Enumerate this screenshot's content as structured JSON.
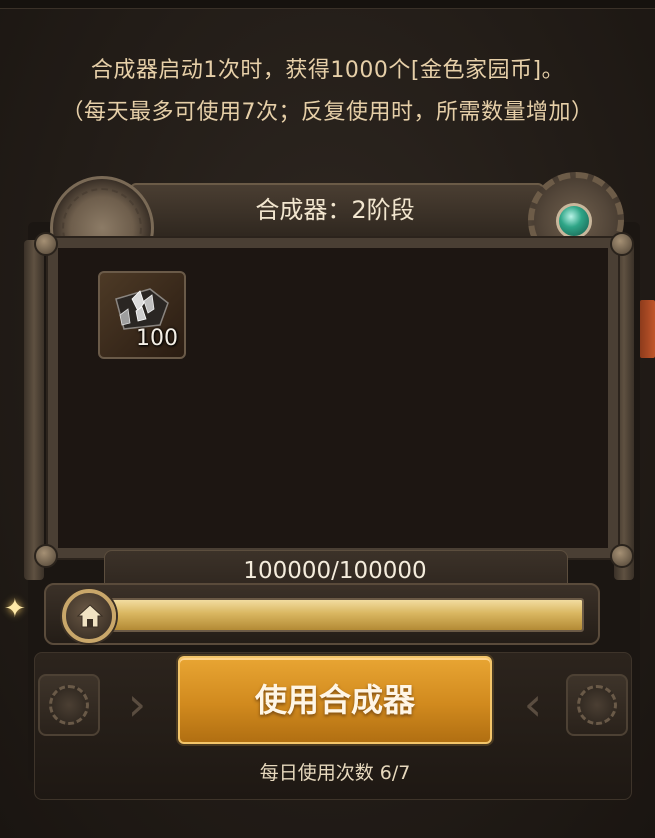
{
  "info": {
    "line1": "合成器启动1次时，获得1000个[金色家园币]。",
    "line2": "（每天最多可使用7次；反复使用时，所需数量增加）"
  },
  "synthesizer": {
    "title": "合成器：2阶段"
  },
  "item": {
    "icon": "crystal-ore-icon",
    "count": "100"
  },
  "progress": {
    "text": "100000/100000",
    "fraction": 1.0
  },
  "controls": {
    "use_button_label": "使用合成器",
    "daily_uses": "每日使用次数 6/7"
  },
  "colors": {
    "button": "#d18a1e",
    "bar_fill": "#d9b660",
    "gem": "#2fa587"
  }
}
